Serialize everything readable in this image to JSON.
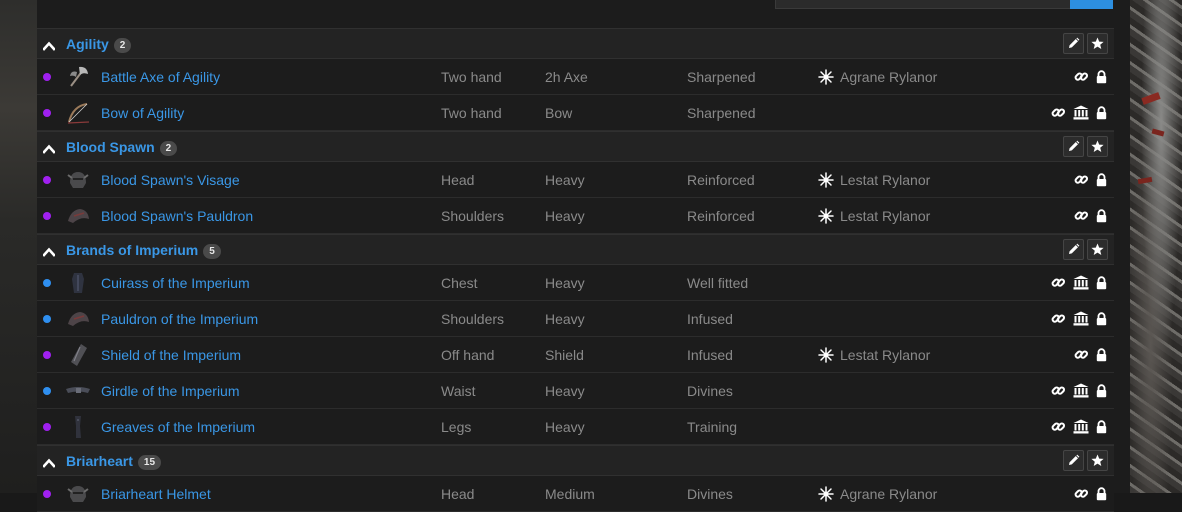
{
  "colors": {
    "accent": "#3a97e6",
    "purple_quality": "#a020f0",
    "blue_quality": "#2f8ff0"
  },
  "group_actions": {
    "edit_icon": "pencil-icon",
    "favorite_icon": "star-icon"
  },
  "item_actions": {
    "link_icon": "link-icon",
    "bank_icon": "bank-icon",
    "lock_icon": "lock-icon"
  },
  "groups": [
    {
      "name": "Agility",
      "count": "2",
      "items": [
        {
          "quality": "purple",
          "name": "Battle Axe of Agility",
          "slot": "Two hand",
          "type": "2h Axe",
          "trait": "Sharpened",
          "crafter": "Agrane Rylanor",
          "bank": false,
          "icon": "axe-icon"
        },
        {
          "quality": "purple",
          "name": "Bow of Agility",
          "slot": "Two hand",
          "type": "Bow",
          "trait": "Sharpened",
          "crafter": "",
          "bank": true,
          "icon": "bow-icon"
        }
      ]
    },
    {
      "name": "Blood Spawn",
      "count": "2",
      "items": [
        {
          "quality": "purple",
          "name": "Blood Spawn's Visage",
          "slot": "Head",
          "type": "Heavy",
          "trait": "Reinforced",
          "crafter": "Lestat Rylanor",
          "bank": false,
          "icon": "helmet-icon"
        },
        {
          "quality": "purple",
          "name": "Blood Spawn's Pauldron",
          "slot": "Shoulders",
          "type": "Heavy",
          "trait": "Reinforced",
          "crafter": "Lestat Rylanor",
          "bank": false,
          "icon": "pauldron-icon"
        }
      ]
    },
    {
      "name": "Brands of Imperium",
      "count": "5",
      "items": [
        {
          "quality": "blue",
          "name": "Cuirass of the Imperium",
          "slot": "Chest",
          "type": "Heavy",
          "trait": "Well fitted",
          "crafter": "",
          "bank": true,
          "icon": "cuirass-icon"
        },
        {
          "quality": "blue",
          "name": "Pauldron of the Imperium",
          "slot": "Shoulders",
          "type": "Heavy",
          "trait": "Infused",
          "crafter": "",
          "bank": true,
          "icon": "pauldron-icon"
        },
        {
          "quality": "purple",
          "name": "Shield of the Imperium",
          "slot": "Off hand",
          "type": "Shield",
          "trait": "Infused",
          "crafter": "Lestat Rylanor",
          "bank": false,
          "icon": "shield-icon"
        },
        {
          "quality": "blue",
          "name": "Girdle of the Imperium",
          "slot": "Waist",
          "type": "Heavy",
          "trait": "Divines",
          "crafter": "",
          "bank": true,
          "icon": "girdle-icon"
        },
        {
          "quality": "purple",
          "name": "Greaves of the Imperium",
          "slot": "Legs",
          "type": "Heavy",
          "trait": "Training",
          "crafter": "",
          "bank": true,
          "icon": "greaves-icon"
        }
      ]
    },
    {
      "name": "Briarheart",
      "count": "15",
      "items": [
        {
          "quality": "purple",
          "name": "Briarheart Helmet",
          "slot": "Head",
          "type": "Medium",
          "trait": "Divines",
          "crafter": "Agrane Rylanor",
          "bank": false,
          "icon": "helmet-icon"
        }
      ]
    }
  ]
}
